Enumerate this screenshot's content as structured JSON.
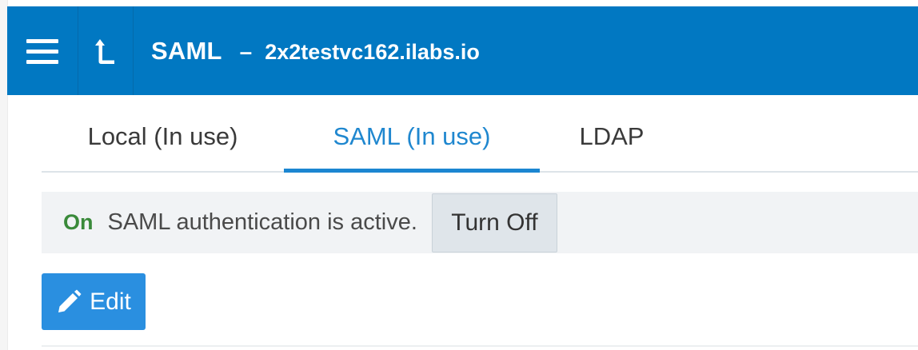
{
  "header": {
    "title": "SAML",
    "separator": "–",
    "host": "2x2testvc162.ilabs.io",
    "menu_icon": "hamburger-menu-icon",
    "up_icon": "arrow-up-return-icon",
    "background_color": "#0178c2"
  },
  "tabs": [
    {
      "label": "Local (In use)",
      "active": false
    },
    {
      "label": "SAML (In use)",
      "active": true
    },
    {
      "label": "LDAP",
      "active": false
    }
  ],
  "status": {
    "state": "On",
    "message": "SAML authentication is active.",
    "turn_off_label": "Turn Off",
    "state_color": "#3a8a3a"
  },
  "actions": {
    "edit_label": "Edit",
    "edit_icon": "pencil-icon",
    "edit_color": "#2a8fe0"
  }
}
